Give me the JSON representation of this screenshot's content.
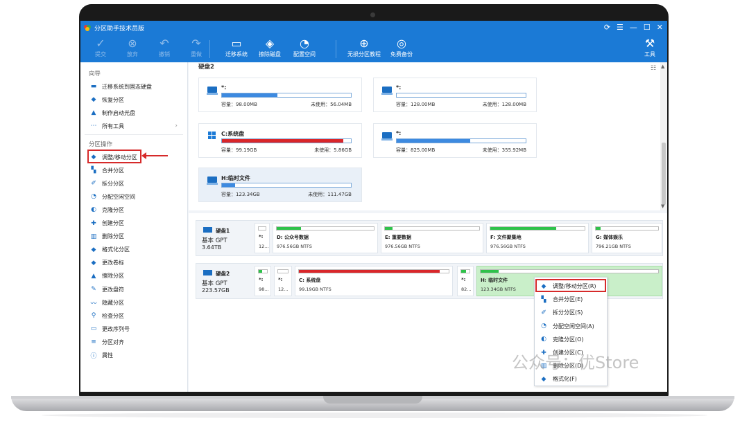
{
  "app": {
    "title": "分区助手技术员版",
    "window_controls": [
      "⟳",
      "☰",
      "—",
      "☐",
      "✕"
    ]
  },
  "toolbar": {
    "items": [
      {
        "label": "提交",
        "icon": "check-icon",
        "enabled": false
      },
      {
        "label": "放弃",
        "icon": "cancel-icon",
        "enabled": false
      },
      {
        "label": "撤销",
        "icon": "undo-icon",
        "enabled": false
      },
      {
        "label": "重做",
        "icon": "redo-icon",
        "enabled": false
      },
      {
        "label": "迁移系统",
        "icon": "migrate-os-icon",
        "enabled": true
      },
      {
        "label": "擦除磁盘",
        "icon": "wipe-disk-icon",
        "enabled": true
      },
      {
        "label": "配置空间",
        "icon": "allocate-space-icon",
        "enabled": true
      },
      {
        "label": "无损分区教程",
        "icon": "shield-plus-icon",
        "enabled": true
      },
      {
        "label": "免费备份",
        "icon": "backup-icon",
        "enabled": true
      }
    ],
    "tools_label": "工具"
  },
  "sidebar": {
    "wizard_title": "向导",
    "wizard_items": [
      {
        "label": "迁移系统到固态硬盘",
        "icon": "migrate-icon"
      },
      {
        "label": "恢复分区",
        "icon": "recover-icon"
      },
      {
        "label": "制作启动光盘",
        "icon": "bootable-disc-icon"
      },
      {
        "label": "所有工具",
        "icon": "more-icon",
        "chevron": "›"
      }
    ],
    "ops_title": "分区操作",
    "ops_items": [
      {
        "label": "调整/移动分区",
        "icon": "resize-move-icon"
      },
      {
        "label": "合并分区",
        "icon": "merge-icon"
      },
      {
        "label": "拆分分区",
        "icon": "split-icon"
      },
      {
        "label": "分配空闲空间",
        "icon": "allocate-icon"
      },
      {
        "label": "克隆分区",
        "icon": "clone-icon"
      },
      {
        "label": "创建分区",
        "icon": "create-icon"
      },
      {
        "label": "删除分区",
        "icon": "delete-icon"
      },
      {
        "label": "格式化分区",
        "icon": "format-icon"
      },
      {
        "label": "更改卷标",
        "icon": "label-icon"
      },
      {
        "label": "擦除分区",
        "icon": "wipe-icon"
      },
      {
        "label": "更改盘符",
        "icon": "drive-letter-icon"
      },
      {
        "label": "隐藏分区",
        "icon": "hide-icon"
      },
      {
        "label": "检查分区",
        "icon": "check-partition-icon"
      },
      {
        "label": "更改序列号",
        "icon": "serial-icon"
      },
      {
        "label": "分区对齐",
        "icon": "align-icon"
      },
      {
        "label": "属性",
        "icon": "info-icon"
      }
    ]
  },
  "top_view": {
    "disk_label": "硬盘2",
    "cards": [
      {
        "name": "*:",
        "used": 0.43,
        "cap": "容量：98.00MB",
        "free": "未使用：56.04MB",
        "win": false,
        "red": false
      },
      {
        "name": "*:",
        "used": 0.0,
        "cap": "容量：128.00MB",
        "free": "未使用：128.00MB",
        "win": false,
        "red": false
      },
      {
        "name": "C:系统盘",
        "used": 0.94,
        "cap": "容量：99.19GB",
        "free": "未使用：5.86GB",
        "win": true,
        "red": true
      },
      {
        "name": "*:",
        "used": 0.57,
        "cap": "容量：825.00MB",
        "free": "未使用：355.92MB",
        "win": false,
        "red": false
      },
      {
        "name": "H:临时文件",
        "used": 0.1,
        "cap": "容量：123.34GB",
        "free": "未使用：111.47GB",
        "win": false,
        "red": false
      }
    ]
  },
  "disk_map": {
    "disks": [
      {
        "name": "硬盘1",
        "type": "基本 GPT",
        "size": "3.64TB",
        "parts": [
          {
            "name": "*:",
            "size": "12...",
            "used": 0.0
          },
          {
            "name": "D: 公众号数据",
            "size": "976.56GB NTFS",
            "used": 0.25
          },
          {
            "name": "E: 重要数据",
            "size": "976.56GB NTFS",
            "used": 0.08
          },
          {
            "name": "F: 文件聚集地",
            "size": "976.56GB NTFS",
            "used": 0.7
          },
          {
            "name": "G: 媒体娱乐",
            "size": "796.21GB NTFS",
            "used": 0.08
          }
        ]
      },
      {
        "name": "硬盘2",
        "type": "基本 GPT",
        "size": "223.57GB",
        "parts": [
          {
            "name": "*:",
            "size": "98...",
            "used": 0.4
          },
          {
            "name": "*:",
            "size": "12...",
            "used": 0.0
          },
          {
            "name": "C: 系统盘",
            "size": "99.19GB NTFS",
            "used": 0.94
          },
          {
            "name": "*:",
            "size": "82...",
            "used": 0.55
          },
          {
            "name": "H: 临时文件",
            "size": "123.34GB NTFS",
            "used": 0.1
          }
        ]
      }
    ]
  },
  "context_menu": {
    "items": [
      {
        "label": "调整/移动分区(R)",
        "icon": "resize-move-icon"
      },
      {
        "label": "合并分区(E)",
        "icon": "merge-icon"
      },
      {
        "label": "拆分分区(S)",
        "icon": "split-icon"
      },
      {
        "label": "分配空闲空间(A)",
        "icon": "allocate-icon"
      },
      {
        "label": "克隆分区(O)",
        "icon": "clone-icon"
      },
      {
        "label": "创建分区(C)",
        "icon": "create-icon"
      },
      {
        "label": "删除分区(D)",
        "icon": "delete-icon"
      },
      {
        "label": "格式化(F)",
        "icon": "format-icon"
      }
    ]
  },
  "watermark": "公众号：优Store",
  "colors": {
    "titlebar": "#1b7ad6",
    "highlight": "#d62a2a",
    "used_bar": "#3d8ae0",
    "system_bar": "#d9262a",
    "map_bar": "#2ec24a",
    "selected_part": "#c9efc9"
  }
}
